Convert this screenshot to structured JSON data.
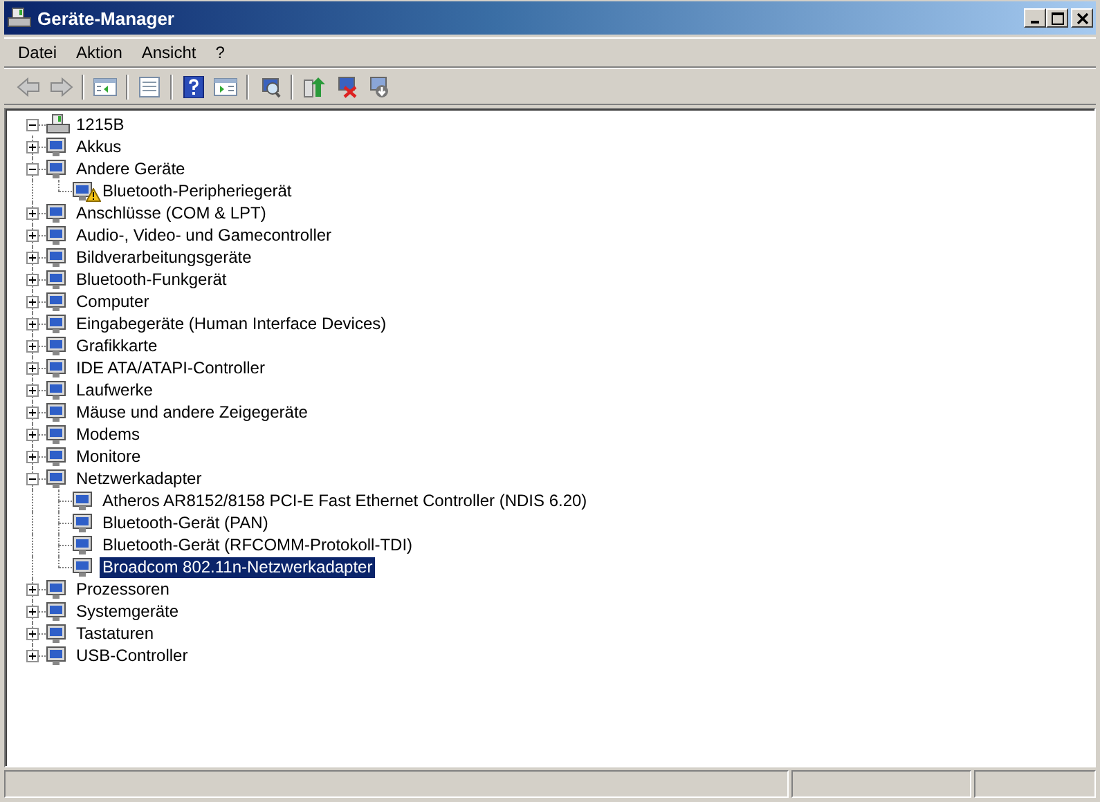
{
  "window": {
    "title": "Geräte-Manager"
  },
  "menu": [
    "Datei",
    "Aktion",
    "Ansicht",
    "?"
  ],
  "tree": {
    "label": "1215B",
    "expanded": true,
    "selected": false,
    "children": [
      {
        "label": "Akkus",
        "expanded": false,
        "selected": false
      },
      {
        "label": "Andere Geräte",
        "expanded": true,
        "selected": false,
        "children": [
          {
            "label": "Bluetooth-Peripheriegerät",
            "selected": false,
            "warning": true
          }
        ]
      },
      {
        "label": "Anschlüsse (COM & LPT)",
        "expanded": false,
        "selected": false
      },
      {
        "label": "Audio-, Video- und Gamecontroller",
        "expanded": false,
        "selected": false
      },
      {
        "label": "Bildverarbeitungsgeräte",
        "expanded": false,
        "selected": false
      },
      {
        "label": "Bluetooth-Funkgerät",
        "expanded": false,
        "selected": false
      },
      {
        "label": "Computer",
        "expanded": false,
        "selected": false
      },
      {
        "label": "Eingabegeräte (Human Interface Devices)",
        "expanded": false,
        "selected": false
      },
      {
        "label": "Grafikkarte",
        "expanded": false,
        "selected": false
      },
      {
        "label": "IDE ATA/ATAPI-Controller",
        "expanded": false,
        "selected": false
      },
      {
        "label": "Laufwerke",
        "expanded": false,
        "selected": false
      },
      {
        "label": "Mäuse und andere Zeigegeräte",
        "expanded": false,
        "selected": false
      },
      {
        "label": "Modems",
        "expanded": false,
        "selected": false
      },
      {
        "label": "Monitore",
        "expanded": false,
        "selected": false
      },
      {
        "label": "Netzwerkadapter",
        "expanded": true,
        "selected": false,
        "children": [
          {
            "label": "Atheros AR8152/8158 PCI-E Fast Ethernet Controller (NDIS 6.20)",
            "selected": false
          },
          {
            "label": "Bluetooth-Gerät (PAN)",
            "selected": false
          },
          {
            "label": "Bluetooth-Gerät (RFCOMM-Protokoll-TDI)",
            "selected": false
          },
          {
            "label": "Broadcom 802.11n-Netzwerkadapter",
            "selected": true
          }
        ]
      },
      {
        "label": "Prozessoren",
        "expanded": false,
        "selected": false
      },
      {
        "label": "Systemgeräte",
        "expanded": false,
        "selected": false
      },
      {
        "label": "Tastaturen",
        "expanded": false,
        "selected": false
      },
      {
        "label": "USB-Controller",
        "expanded": false,
        "selected": false
      }
    ]
  }
}
